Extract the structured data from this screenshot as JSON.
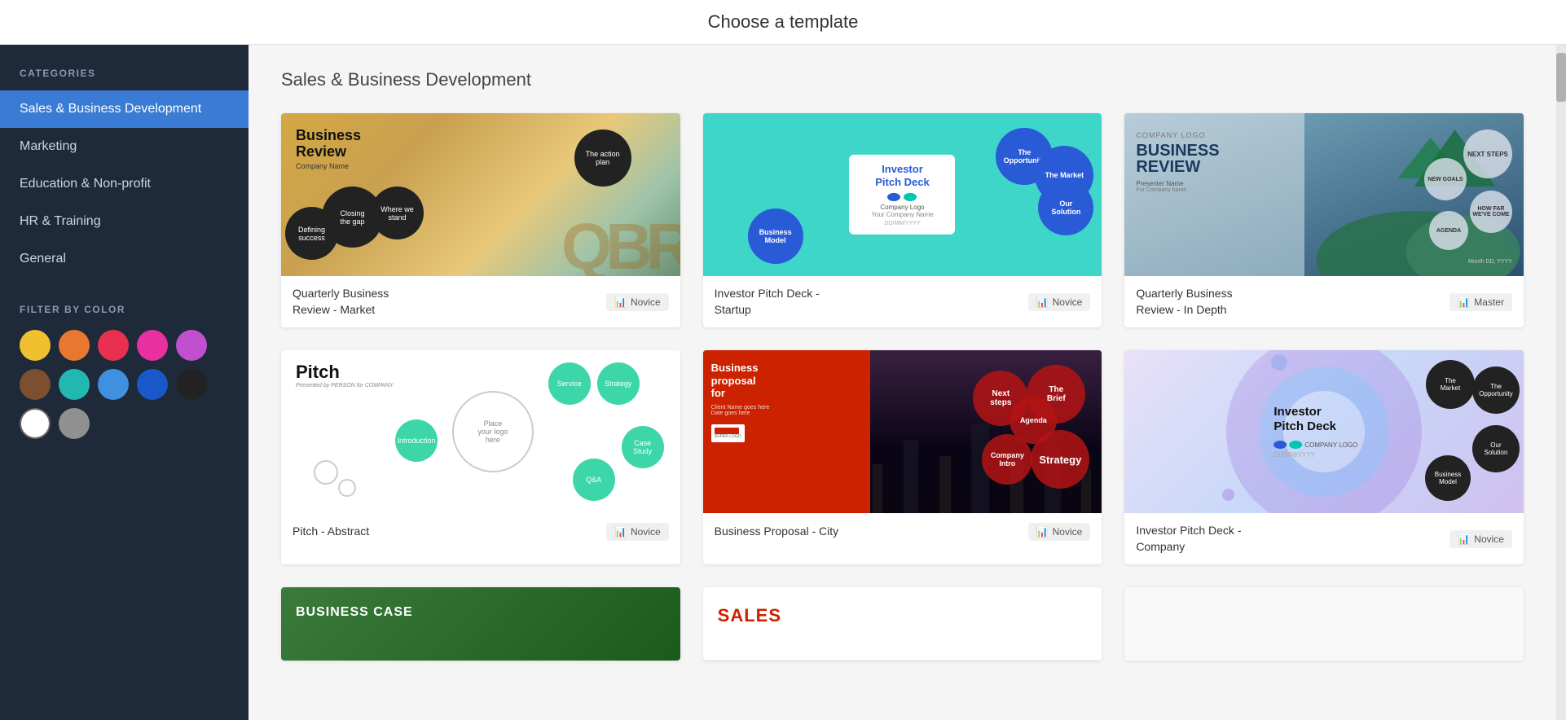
{
  "header": {
    "title": "Choose a template"
  },
  "sidebar": {
    "categories_label": "CATEGORIES",
    "items": [
      {
        "id": "sales",
        "label": "Sales & Business Development",
        "active": true
      },
      {
        "id": "marketing",
        "label": "Marketing",
        "active": false
      },
      {
        "id": "education",
        "label": "Education & Non-profit",
        "active": false
      },
      {
        "id": "hr",
        "label": "HR & Training",
        "active": false
      },
      {
        "id": "general",
        "label": "General",
        "active": false
      }
    ],
    "filter_label": "FILTER BY COLOR",
    "colors": [
      {
        "name": "yellow",
        "hex": "#f0c030"
      },
      {
        "name": "orange",
        "hex": "#e87830"
      },
      {
        "name": "red",
        "hex": "#e83050"
      },
      {
        "name": "pink",
        "hex": "#e830a0"
      },
      {
        "name": "purple",
        "hex": "#c050d0"
      },
      {
        "name": "brown",
        "hex": "#7a5030"
      },
      {
        "name": "teal",
        "hex": "#20b8b0"
      },
      {
        "name": "light-blue",
        "hex": "#4090e0"
      },
      {
        "name": "dark-blue",
        "hex": "#1858c8"
      },
      {
        "name": "black",
        "hex": "#222222"
      },
      {
        "name": "white",
        "hex": "#ffffff"
      },
      {
        "name": "gray",
        "hex": "#909090"
      }
    ]
  },
  "content": {
    "section_title": "Sales & Business Development",
    "templates": [
      {
        "id": "qbr-market",
        "name": "Quarterly Business Review - Market",
        "badge": "Novice",
        "thumbnail_type": "qbr-market"
      },
      {
        "id": "investor-startup",
        "name": "Investor Pitch Deck - Startup",
        "badge": "Novice",
        "thumbnail_type": "investor-startup"
      },
      {
        "id": "qbr-depth",
        "name": "Quarterly Business Review - In Depth",
        "badge": "Master",
        "thumbnail_type": "qbr-depth"
      },
      {
        "id": "pitch-abstract",
        "name": "Pitch - Abstract",
        "badge": "Novice",
        "thumbnail_type": "pitch-abstract"
      },
      {
        "id": "biz-proposal",
        "name": "Business Proposal - City",
        "badge": "Novice",
        "thumbnail_type": "biz-proposal"
      },
      {
        "id": "investor-company",
        "name": "Investor Pitch Deck - Company",
        "badge": "Novice",
        "thumbnail_type": "investor-company"
      }
    ],
    "partial_templates": [
      {
        "id": "biz-case",
        "thumbnail_type": "biz-case",
        "label": "BUSINESS CASE"
      },
      {
        "id": "sales",
        "thumbnail_type": "sales",
        "label": "SALES"
      },
      {
        "id": "white-partial",
        "thumbnail_type": "white-partial",
        "label": ""
      }
    ]
  }
}
